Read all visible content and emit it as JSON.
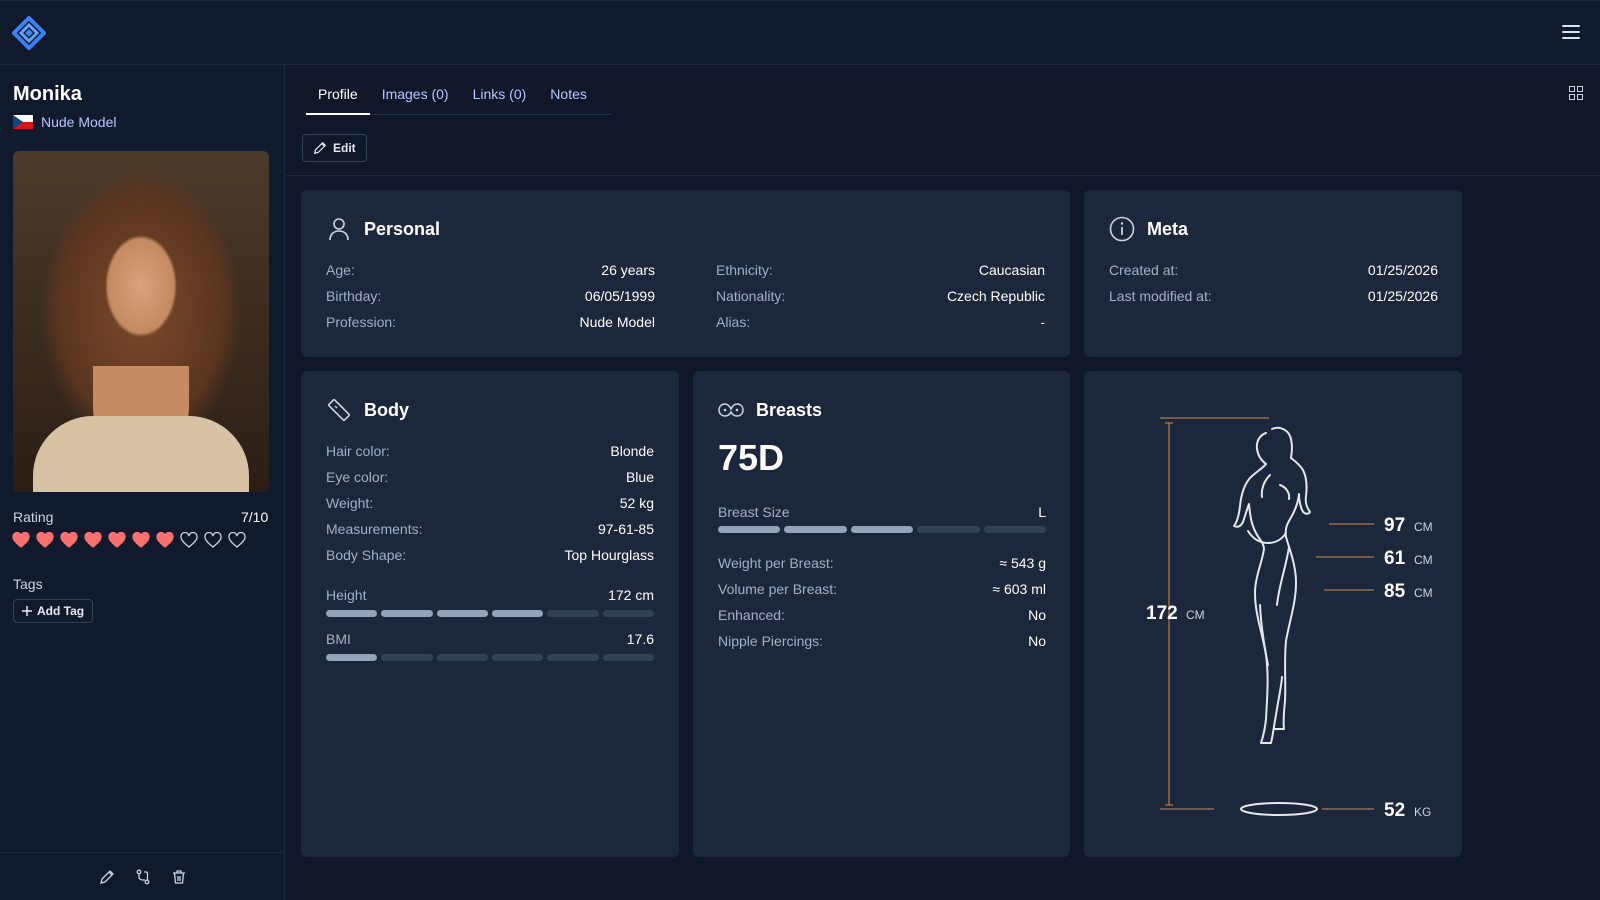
{
  "colors": {
    "background": "#0f1729",
    "card": "#1c273b",
    "heart_on": "#f87171",
    "accent_line": "#a87a4f"
  },
  "header": {
    "logo_icon": "diamond-logo-icon",
    "menu_icon": "hamburger-icon"
  },
  "sidebar": {
    "name": "Monika",
    "flag_icon": "czech-flag-icon",
    "profession": "Nude Model",
    "rating_label": "Rating",
    "rating_value": "7/10",
    "rating": 7,
    "rating_max": 10,
    "tags_label": "Tags",
    "add_tag_label": "Add Tag",
    "footer_icons": [
      "pencil-icon",
      "merge-icon",
      "trash-icon"
    ]
  },
  "tabs": [
    {
      "label": "Profile",
      "active": true
    },
    {
      "label": "Images (0)",
      "active": false
    },
    {
      "label": "Links (0)",
      "active": false
    },
    {
      "label": "Notes",
      "active": false
    }
  ],
  "toolbar": {
    "edit_label": "Edit"
  },
  "personal": {
    "title": "Personal",
    "left": [
      {
        "k": "Age:",
        "v": "26 years"
      },
      {
        "k": "Birthday:",
        "v": "06/05/1999"
      },
      {
        "k": "Profession:",
        "v": "Nude Model"
      }
    ],
    "right": [
      {
        "k": "Ethnicity:",
        "v": "Caucasian"
      },
      {
        "k": "Nationality:",
        "v": "Czech Republic"
      },
      {
        "k": "Alias:",
        "v": "-"
      }
    ]
  },
  "meta": {
    "title": "Meta",
    "rows": [
      {
        "k": "Created at:",
        "v": "01/25/2026"
      },
      {
        "k": "Last modified at:",
        "v": "01/25/2026"
      }
    ]
  },
  "body": {
    "title": "Body",
    "rows": [
      {
        "k": "Hair color:",
        "v": "Blonde"
      },
      {
        "k": "Eye color:",
        "v": "Blue"
      },
      {
        "k": "Weight:",
        "v": "52 kg"
      },
      {
        "k": "Measurements:",
        "v": "97-61-85"
      },
      {
        "k": "Body Shape:",
        "v": "Top Hourglass"
      }
    ],
    "height_label": "Height",
    "height_value": "172 cm",
    "height_level": 4,
    "bmi_label": "BMI",
    "bmi_value": "17.6",
    "bmi_level": 1,
    "scale_segments": 6
  },
  "breasts": {
    "title": "Breasts",
    "size": "75D",
    "size_label": "Breast Size",
    "size_value": "L",
    "size_level": 3,
    "size_segments": 5,
    "rows": [
      {
        "k": "Weight per Breast:",
        "v": "≈ 543 g"
      },
      {
        "k": "Volume per Breast:",
        "v": "≈ 603 ml"
      },
      {
        "k": "Enhanced:",
        "v": "No"
      },
      {
        "k": "Nipple Piercings:",
        "v": "No"
      }
    ]
  },
  "figure": {
    "height_value": "172",
    "height_unit": "CM",
    "bust_value": "97",
    "waist_value": "61",
    "hips_value": "85",
    "unit_cm": "CM",
    "weight_value": "52",
    "weight_unit": "KG"
  }
}
